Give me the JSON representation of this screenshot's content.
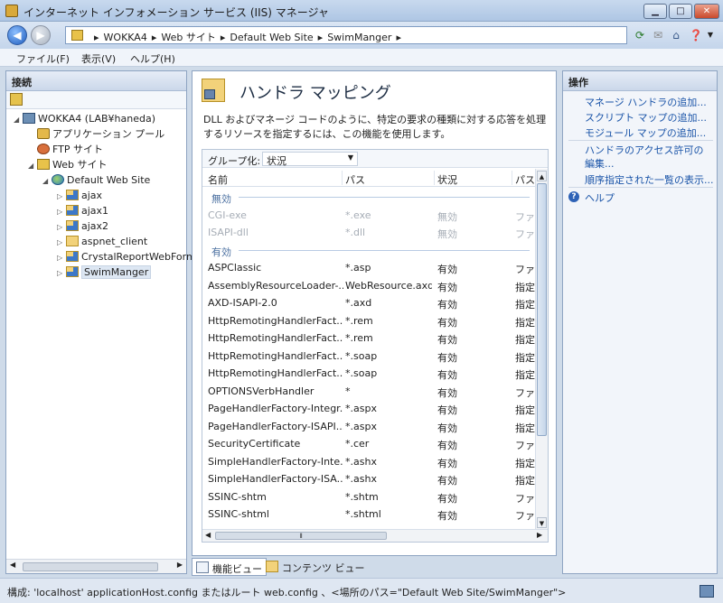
{
  "window": {
    "title": "インターネット インフォメーション サービス (IIS) マネージャ"
  },
  "address": {
    "crumbs": [
      "WOKKA4",
      "Web サイト",
      "Default Web Site",
      "SwimManger"
    ]
  },
  "menu": [
    "ファイル(F)",
    "表示(V)",
    "ヘルプ(H)"
  ],
  "left": {
    "header": "接続",
    "tree": [
      {
        "label": "WOKKA4 (LAB¥haneda)",
        "icon": "server-icon",
        "level": 0,
        "twisty": "◢"
      },
      {
        "label": "アプリケーション プール",
        "icon": "app-pool-icon",
        "level": 1,
        "twisty": ""
      },
      {
        "label": "FTP サイト",
        "icon": "ftp-icon",
        "level": 1,
        "twisty": ""
      },
      {
        "label": "Web サイト",
        "icon": "sites-icon",
        "level": 1,
        "twisty": "◢"
      },
      {
        "label": "Default Web Site",
        "icon": "globe-icon",
        "level": 2,
        "twisty": "◢"
      },
      {
        "label": "ajax",
        "icon": "application-icon",
        "level": 3,
        "twisty": "▷"
      },
      {
        "label": "ajax1",
        "icon": "application-icon",
        "level": 3,
        "twisty": "▷"
      },
      {
        "label": "ajax2",
        "icon": "application-icon",
        "level": 3,
        "twisty": "▷"
      },
      {
        "label": "aspnet_client",
        "icon": "folder-icon",
        "level": 3,
        "twisty": "▷"
      },
      {
        "label": "CrystalReportWebForm",
        "icon": "application-icon",
        "level": 3,
        "twisty": "▷"
      },
      {
        "label": "SwimManger",
        "icon": "application-icon",
        "level": 3,
        "twisty": "▷",
        "selected": true
      }
    ]
  },
  "center": {
    "title": "ハンドラ マッピング",
    "description": "DLL およびマネージ コードのように、特定の要求の種類に対する応答を処理するリソースを指定するには、この機能を使用します。",
    "group_label": "グループ化:",
    "group_value": "状況",
    "columns": [
      "名前",
      "パス",
      "状況",
      "パス"
    ],
    "groups": [
      {
        "label": "無効",
        "disabled": true,
        "rows": [
          [
            "CGI-exe",
            "*.exe",
            "無効",
            "ファ"
          ],
          [
            "ISAPI-dll",
            "*.dll",
            "無効",
            "ファ"
          ]
        ]
      },
      {
        "label": "有効",
        "disabled": false,
        "rows": [
          [
            "ASPClassic",
            "*.asp",
            "有効",
            "ファ"
          ],
          [
            "AssemblyResourceLoader-...",
            "WebResource.axd",
            "有効",
            "指定"
          ],
          [
            "AXD-ISAPI-2.0",
            "*.axd",
            "有効",
            "指定"
          ],
          [
            "HttpRemotingHandlerFact...",
            "*.rem",
            "有効",
            "指定"
          ],
          [
            "HttpRemotingHandlerFact...",
            "*.rem",
            "有効",
            "指定"
          ],
          [
            "HttpRemotingHandlerFact...",
            "*.soap",
            "有効",
            "指定"
          ],
          [
            "HttpRemotingHandlerFact...",
            "*.soap",
            "有効",
            "指定"
          ],
          [
            "OPTIONSVerbHandler",
            "*",
            "有効",
            "ファ"
          ],
          [
            "PageHandlerFactory-Integr...",
            "*.aspx",
            "有効",
            "指定"
          ],
          [
            "PageHandlerFactory-ISAPI...",
            "*.aspx",
            "有効",
            "指定"
          ],
          [
            "SecurityCertificate",
            "*.cer",
            "有効",
            "ファ"
          ],
          [
            "SimpleHandlerFactory-Inte...",
            "*.ashx",
            "有効",
            "指定"
          ],
          [
            "SimpleHandlerFactory-ISA...",
            "*.ashx",
            "有効",
            "指定"
          ],
          [
            "SSINC-shtm",
            "*.shtm",
            "有効",
            "ファ"
          ],
          [
            "SSINC-shtml",
            "*.shtml",
            "有効",
            "ファ"
          ]
        ]
      }
    ],
    "tabs": [
      "機能ビュー",
      "コンテンツ ビュー"
    ]
  },
  "right": {
    "header": "操作",
    "actions": [
      "マネージ ハンドラの追加...",
      "スクリプト マップの追加...",
      "モジュール マップの追加..."
    ],
    "actions2": [
      "ハンドラのアクセス許可の編集...",
      "順序指定された一覧の表示..."
    ],
    "help": "ヘルプ"
  },
  "status": "構成: 'localhost' applicationHost.config またはルート web.config 、<場所のパス=\"Default Web Site/SwimManger\">"
}
